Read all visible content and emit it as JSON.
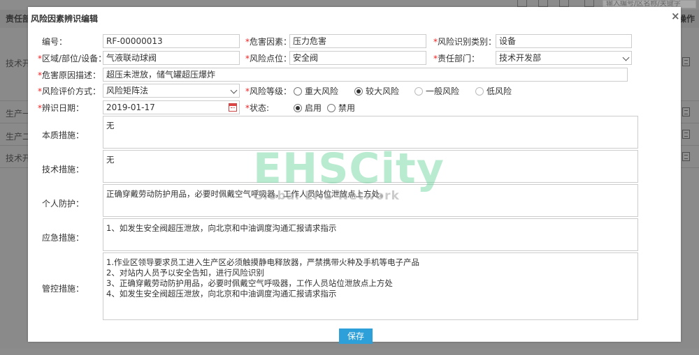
{
  "background": {
    "search_placeholder": "输入编号/区名称/关键字",
    "panel_title": "责任部",
    "operation_header": "操作",
    "rows": [
      "技术开",
      "生产一",
      "生产二",
      "技术开"
    ]
  },
  "dialog": {
    "title": "风险因素辨识编辑",
    "close_glyph": "×",
    "fields": {
      "code": {
        "label": "编号：",
        "value": "RF-00000013"
      },
      "hazard": {
        "label": "*危害因素：",
        "value": "压力危害"
      },
      "category": {
        "label": "*风险识别类别：",
        "value": "设备"
      },
      "area": {
        "label": "*区域/部位/设备：",
        "value": "气液联动球阀"
      },
      "risk_point": {
        "label": "*风险点位：",
        "value": "安全阀"
      },
      "dept": {
        "label": "*责任部门：",
        "value": "技术开发部"
      },
      "cause": {
        "label": "*危害原因描述：",
        "value": "超压未泄放，储气罐超压爆炸"
      },
      "method": {
        "label": "*风险评价方式：",
        "value": "风险矩阵法"
      },
      "level": {
        "label": "*风险等级：",
        "options": [
          "重大风险",
          "较大风险",
          "一般风险",
          "低风险"
        ],
        "selected": "较大风险"
      },
      "date": {
        "label": "*辨识日期：",
        "value": "2019-01-17"
      },
      "status": {
        "label": "*状态:",
        "options": [
          "启用",
          "禁用"
        ],
        "selected": "启用"
      }
    },
    "measures": {
      "intrinsic": {
        "label": "本质措施：",
        "lines": [
          "无"
        ]
      },
      "technical": {
        "label": "技术措施：",
        "lines": [
          "无"
        ]
      },
      "personal": {
        "label": "个人防护：",
        "lines": [
          "正确穿戴劳动防护用品，必要时佩戴空气呼吸器，工作人员站位泄放点上方处。"
        ]
      },
      "emergency": {
        "label": "应急措施：",
        "lines": [
          "1、如发生安全阀超压泄放，向北京和中油调度沟通汇报请求指示"
        ]
      },
      "control": {
        "label": "管控措施：",
        "lines": [
          "1.作业区领导要求员工进入生产区必须触摸静电释放器，严禁携带火种及手机等电子产品",
          "2、对站内人员予以安全告知，进行风险识别",
          "3、正确穿戴劳动防护用品，必要时佩戴空气呼吸器，工作人员站位泄放点上方处",
          "4、如发生安全阀超压泄放，向北京和中油调度沟通汇报请求指示"
        ]
      }
    },
    "save_label": "保存"
  },
  "watermark": {
    "brand": "EHSCity",
    "tagline": "Global EHS Network"
  }
}
